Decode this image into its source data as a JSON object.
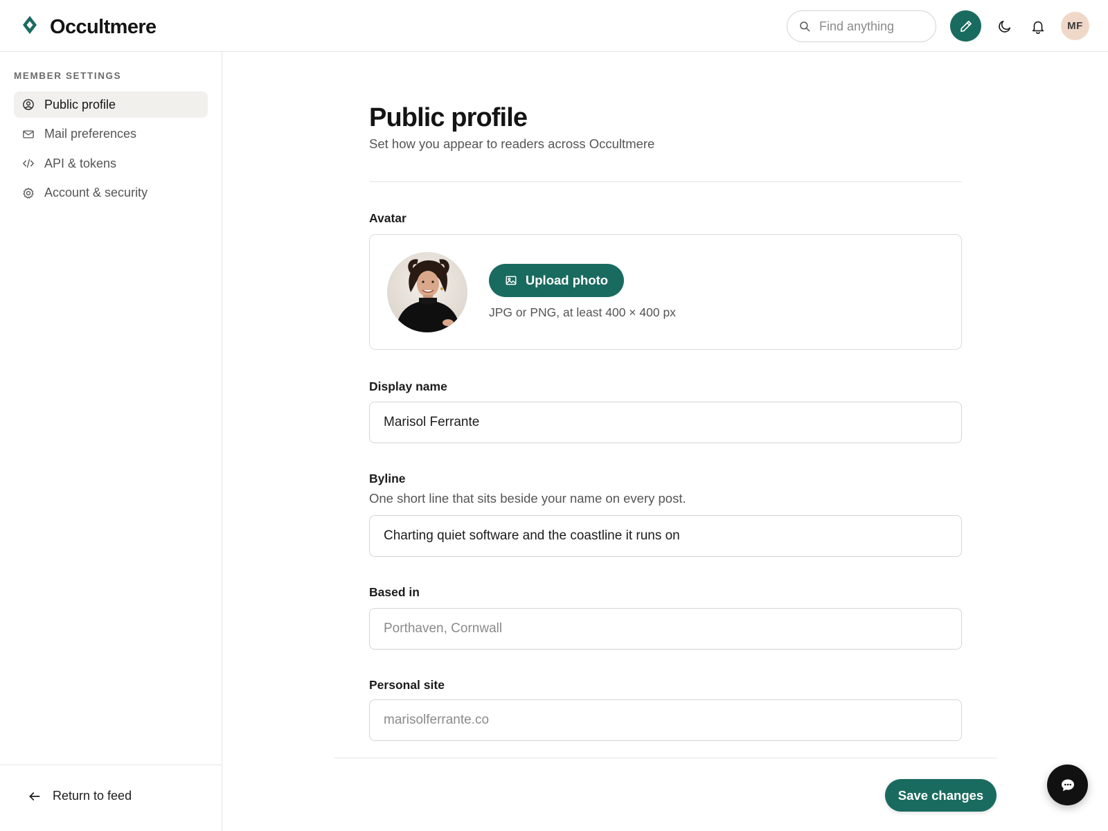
{
  "app": {
    "name": "Occultmere",
    "logo_icon": "diamond-logo-icon",
    "accent_color": "#1a6b5f"
  },
  "header": {
    "search_placeholder": "Find anything",
    "search_icon": "search-icon",
    "compose_icon": "pencil-icon",
    "theme_icon": "moon-icon",
    "notifications_icon": "bell-icon",
    "user_initials": "MF"
  },
  "sidebar": {
    "heading": "MEMBER SETTINGS",
    "items": [
      {
        "label": "Public profile",
        "icon": "user-circle-icon",
        "active": true
      },
      {
        "label": "Mail preferences",
        "icon": "mail-icon",
        "active": false
      },
      {
        "label": "API & tokens",
        "icon": "code-icon",
        "active": false
      },
      {
        "label": "Account & security",
        "icon": "gear-icon",
        "active": false
      }
    ],
    "return_label": "Return to feed",
    "return_icon": "arrow-left-icon"
  },
  "main": {
    "title": "Public profile",
    "subtitle": "Set how you appear to readers across Occultmere",
    "avatar": {
      "label": "Avatar",
      "upload_label": "Upload photo",
      "upload_icon": "image-icon",
      "hint": "JPG or PNG, at least 400 × 400 px"
    },
    "display_name": {
      "label": "Display name",
      "value": "Marisol Ferrante"
    },
    "byline": {
      "label": "Byline",
      "hint": "One short line that sits beside your name on every post.",
      "value": "Charting quiet software and the coastline it runs on"
    },
    "based_in": {
      "label": "Based in",
      "placeholder": "Porthaven, Cornwall"
    },
    "personal_site": {
      "label": "Personal site",
      "placeholder": "marisolferrante.co"
    },
    "save_label": "Save changes"
  },
  "chat_icon": "chat-bubble-icon"
}
